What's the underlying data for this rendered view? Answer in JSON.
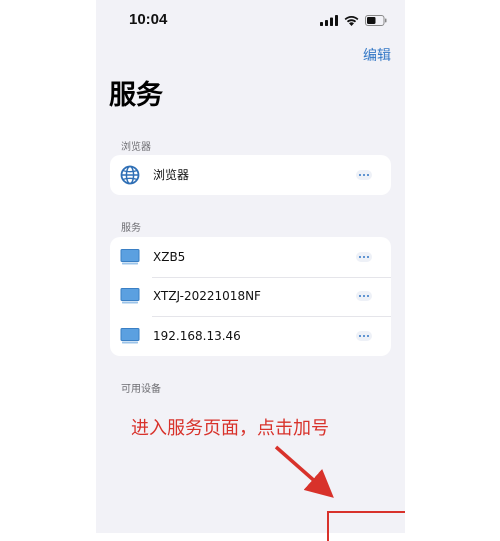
{
  "status_bar": {
    "time": "10:04"
  },
  "header": {
    "edit_label": "编辑",
    "title": "服务"
  },
  "sections": {
    "browser": {
      "header": "浏览器",
      "items": [
        {
          "label": "浏览器",
          "icon": "globe-icon"
        }
      ]
    },
    "services": {
      "header": "服务",
      "items": [
        {
          "label": "XZB5",
          "icon": "monitor-icon"
        },
        {
          "label": "XTZJ-20221018NF",
          "icon": "monitor-icon"
        },
        {
          "label": "192.168.13.46",
          "icon": "monitor-icon"
        }
      ]
    },
    "available": {
      "header": "可用设备"
    }
  },
  "annotation": {
    "text": "进入服务页面，点击加号",
    "color": "#d8322b"
  },
  "colors": {
    "accent": "#3478c6",
    "background": "#f2f2f7",
    "annotation": "#d8322b"
  }
}
